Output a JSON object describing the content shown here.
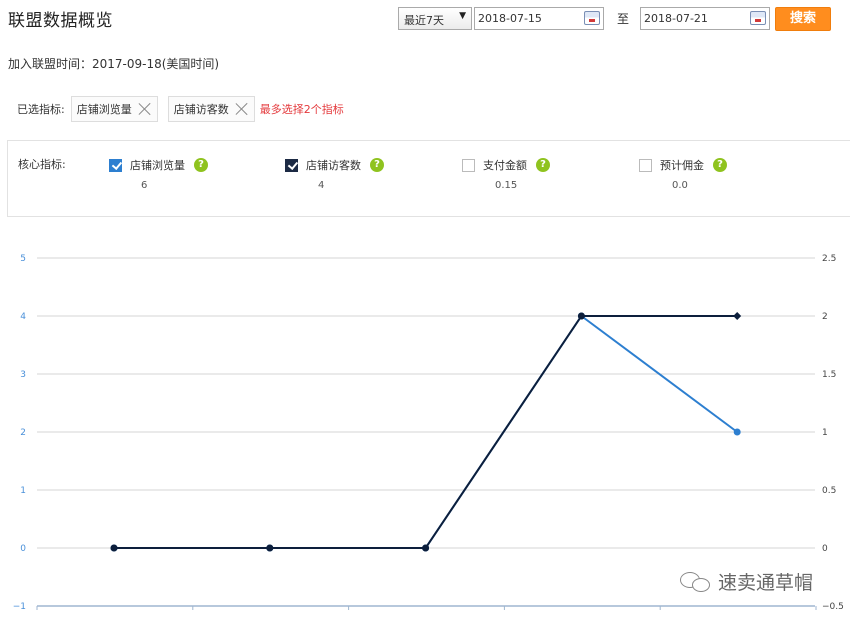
{
  "header": {
    "title": "联盟数据概览",
    "range_select": "最近7天",
    "start_date": "2018-07-15",
    "to_label": "至",
    "end_date": "2018-07-21",
    "search_label": "搜索"
  },
  "join_time": "加入联盟时间：2017-09-18(美国时间)",
  "selected": {
    "label": "已选指标:",
    "chips": [
      "店铺浏览量",
      "店铺访客数"
    ],
    "note": "最多选择2个指标"
  },
  "core": {
    "label": "核心指标:",
    "metrics": [
      {
        "name": "店铺浏览量",
        "value": "6",
        "checked": true,
        "color": "#2d7fd0"
      },
      {
        "name": "店铺访客数",
        "value": "4",
        "checked": true,
        "color": "#1c2a44"
      },
      {
        "name": "支付金额",
        "value": "0.15",
        "checked": false
      },
      {
        "name": "预计佣金",
        "value": "0.0",
        "checked": false
      }
    ],
    "help_glyph": "?"
  },
  "chart_data": {
    "type": "line",
    "x": [
      1,
      2,
      3,
      4,
      5
    ],
    "left_axis": {
      "min": -1,
      "max": 5,
      "ticks": [
        "−1",
        "0",
        "1",
        "2",
        "3",
        "4",
        "5"
      ],
      "color": "#4a90d9"
    },
    "right_axis": {
      "min": -0.5,
      "max": 2.5,
      "ticks": [
        "−0.5",
        "0",
        "0.5",
        "1",
        "1.5",
        "2",
        "2.5"
      ]
    },
    "grid": true,
    "series": [
      {
        "color": "#2d7fd0",
        "axis": "left",
        "values": [
          0,
          0,
          0,
          4,
          2
        ]
      },
      {
        "color": "#0d1f3c",
        "axis": "right",
        "values": [
          0,
          0,
          0,
          2,
          2
        ]
      }
    ]
  },
  "watermark": "速卖通草帽"
}
